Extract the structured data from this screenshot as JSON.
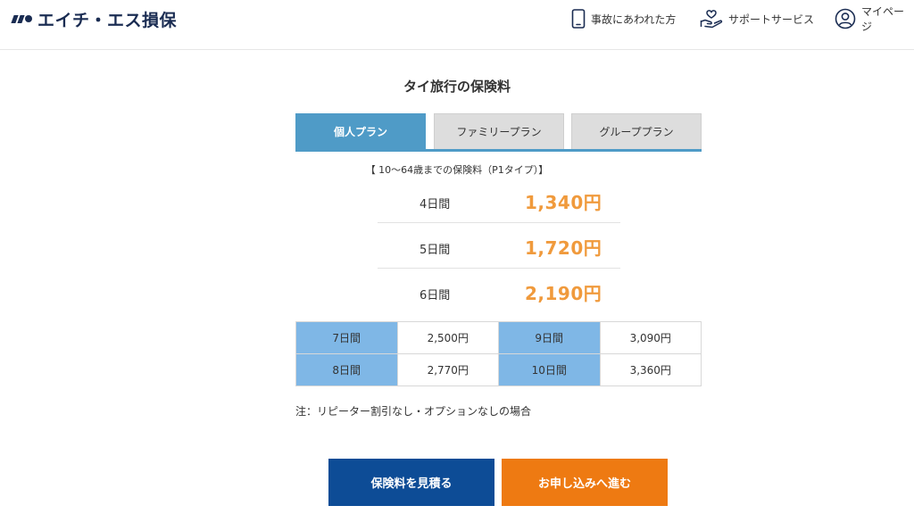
{
  "header": {
    "logo_text": "エイチ・エス損保",
    "nav": {
      "accident": "事故にあわれた方",
      "support": "サポートサービス",
      "mypage": "マイページ"
    }
  },
  "main": {
    "title": "タイ旅行の保険料",
    "tabs": [
      {
        "label": "個人プラン",
        "active": true
      },
      {
        "label": "ファミリープラン",
        "active": false
      },
      {
        "label": "グループプラン",
        "active": false
      }
    ],
    "subtitle": "【 10〜64歳までの保険料（P1タイプ）】",
    "prices": [
      {
        "days": "4日間",
        "amount": "1,340円"
      },
      {
        "days": "5日間",
        "amount": "1,720円"
      },
      {
        "days": "6日間",
        "amount": "2,190円"
      }
    ],
    "rate_table": [
      [
        {
          "days": "7日間",
          "price": "2,500円"
        },
        {
          "days": "9日間",
          "price": "3,090円"
        }
      ],
      [
        {
          "days": "8日間",
          "price": "2,770円"
        },
        {
          "days": "10日間",
          "price": "3,360円"
        }
      ]
    ],
    "note": "注：リピーター割引なし・オプションなしの場合",
    "buttons": {
      "estimate": "保険料を見積る",
      "apply": "お申し込みへ進む"
    }
  },
  "colors": {
    "brand_navy": "#1a2c52",
    "tab_active": "#4f9bc7",
    "price_orange": "#f09a3c",
    "table_days_bg": "#7fb7e6",
    "estimate_button": "#0d4c96",
    "apply_button": "#ee7a12"
  },
  "icons": {
    "accident": "smartphone-icon",
    "support": "hand-heart-icon",
    "mypage": "user-icon"
  }
}
